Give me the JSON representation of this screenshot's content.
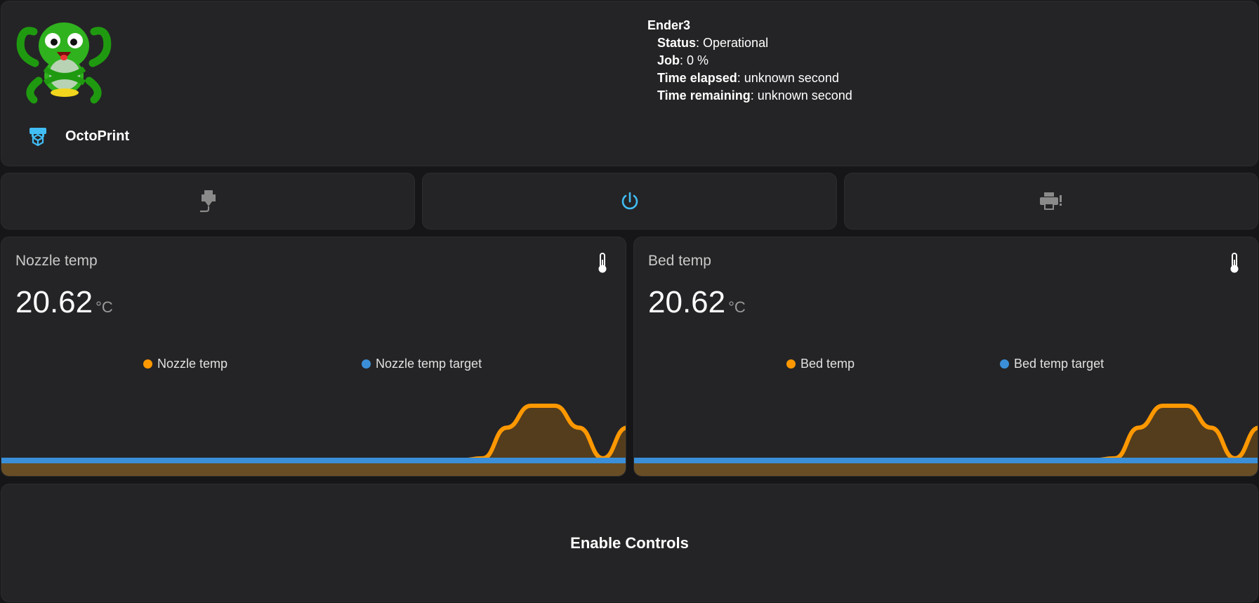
{
  "header": {
    "brand_label": "OctoPrint",
    "printer_name": "Ender3",
    "status_label": "Status",
    "status_value": ": Operational",
    "job_label": "Job",
    "job_value": ": 0 %",
    "elapsed_label": "Time elapsed",
    "elapsed_value": ": unknown second",
    "remaining_label": "Time remaining",
    "remaining_value": ": unknown second"
  },
  "actions": {
    "filament_icon": "extruder-icon",
    "power_icon": "power-icon",
    "print_icon": "printer-alert-icon"
  },
  "nozzle": {
    "title": "Nozzle temp",
    "value": "20.62",
    "unit": "°C",
    "legend": [
      "Nozzle temp",
      "Nozzle temp target"
    ]
  },
  "bed": {
    "title": "Bed temp",
    "value": "20.62",
    "unit": "°C",
    "legend": [
      "Bed temp",
      "Bed temp target"
    ]
  },
  "controls": {
    "label": "Enable Controls"
  },
  "colors": {
    "accent": "#41bdf5",
    "temp_series": "#ff9800",
    "target_series": "#3b8fd8",
    "card_bg": "#242426"
  },
  "chart_data": [
    {
      "type": "area",
      "series": [
        {
          "name": "Nozzle temp",
          "values": [
            20.6,
            20.6,
            20.6,
            20.6,
            20.6,
            20.6,
            20.6,
            20.6,
            20.6,
            20.6,
            20.6,
            20.6,
            20.6,
            20.6,
            20.6,
            20.6,
            20.6,
            20.6,
            20.6,
            20.6,
            20.62,
            20.9,
            21.1,
            21.1,
            20.9,
            20.62,
            20.9
          ]
        },
        {
          "name": "Nozzle temp target",
          "values": [
            0,
            0,
            0,
            0,
            0,
            0,
            0,
            0,
            0,
            0,
            0,
            0,
            0,
            0,
            0,
            0,
            0,
            0,
            0,
            0,
            0,
            0,
            0,
            0,
            0,
            0,
            0
          ]
        }
      ],
      "title": "",
      "xlabel": "",
      "ylabel": ""
    },
    {
      "type": "area",
      "series": [
        {
          "name": "Bed temp",
          "values": [
            20.6,
            20.6,
            20.6,
            20.6,
            20.6,
            20.6,
            20.6,
            20.6,
            20.6,
            20.6,
            20.6,
            20.6,
            20.6,
            20.6,
            20.6,
            20.6,
            20.6,
            20.6,
            20.6,
            20.6,
            20.62,
            20.9,
            21.1,
            21.1,
            20.9,
            20.62,
            20.9
          ]
        },
        {
          "name": "Bed temp target",
          "values": [
            0,
            0,
            0,
            0,
            0,
            0,
            0,
            0,
            0,
            0,
            0,
            0,
            0,
            0,
            0,
            0,
            0,
            0,
            0,
            0,
            0,
            0,
            0,
            0,
            0,
            0,
            0
          ]
        }
      ],
      "title": "",
      "xlabel": "",
      "ylabel": ""
    }
  ]
}
